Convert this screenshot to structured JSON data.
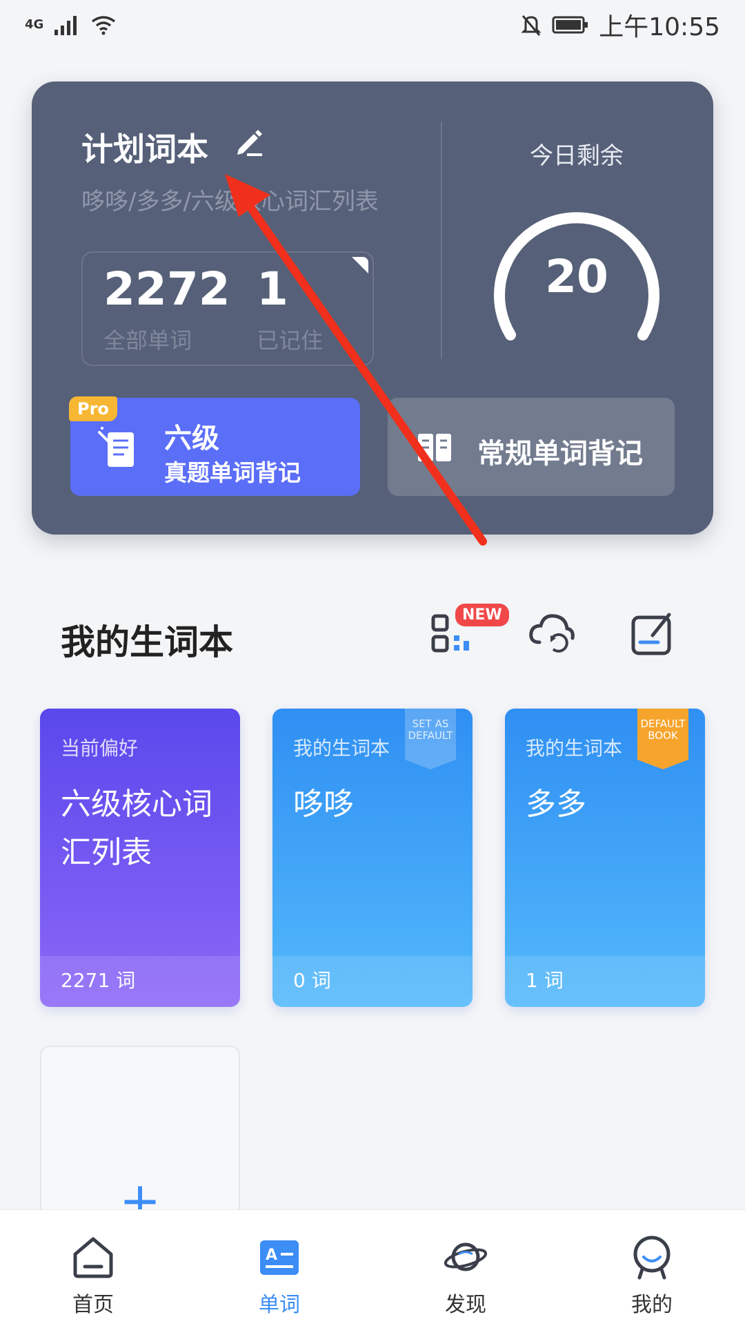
{
  "status_bar": {
    "network": "4G",
    "time": "上午10:55"
  },
  "plan": {
    "title": "计划词本",
    "subtitle": "哆哆/多多/六级核心词汇列表",
    "total_words": "2272",
    "total_label": "全部单词",
    "remembered": "1",
    "remembered_label": "已记住",
    "today_label": "今日剩余",
    "today_remaining": 20,
    "today_remaining_text": "20",
    "pro_badge": "Pro",
    "pro_button_line1": "六级",
    "pro_button_line2": "真题单词背记",
    "regular_button": "常规单词背记"
  },
  "section": {
    "title": "我的生词本",
    "new_badge": "NEW",
    "tools": [
      "qr-scan-icon",
      "cloud-sync-icon",
      "note-edit-icon"
    ]
  },
  "books": [
    {
      "category": "当前偏好",
      "name": "六级核心词汇列表",
      "count": "2271 词"
    },
    {
      "category": "我的生词本",
      "name": "哆哆",
      "count": "0 词",
      "ribbon": "SET AS DEFAULT"
    },
    {
      "category": "我的生词本",
      "name": "多多",
      "count": "1 词",
      "ribbon": "DEFAULT BOOK"
    }
  ],
  "add_book": {
    "symbol": "+"
  },
  "tabs": [
    {
      "label": "首页",
      "icon": "home-icon"
    },
    {
      "label": "单词",
      "icon": "words-icon",
      "active": true
    },
    {
      "label": "发现",
      "icon": "planet-icon"
    },
    {
      "label": "我的",
      "icon": "profile-icon"
    }
  ],
  "colors": {
    "card_bg": "#566078",
    "accent_blue": "#3c8df5",
    "pro_button": "#5b6ef8",
    "pro_badge": "#f7b733",
    "new_badge": "#f04848",
    "annotation_arrow": "#f0301c"
  }
}
